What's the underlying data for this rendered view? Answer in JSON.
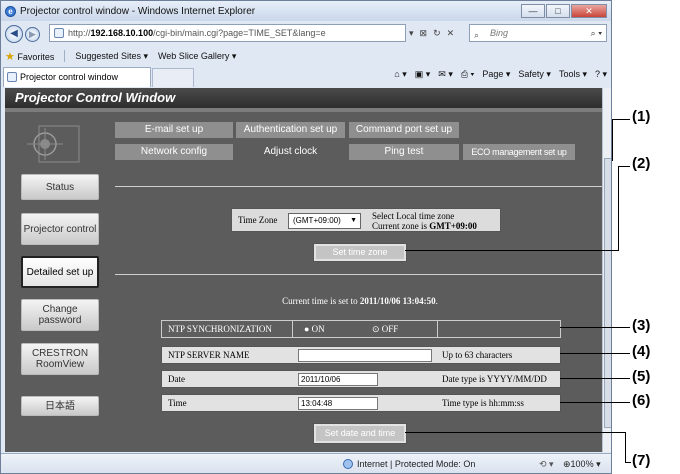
{
  "browser": {
    "window_title": "Projector control window - Windows Internet Explorer",
    "address_prefix": "http://",
    "address_host": "192.168.10.100",
    "address_path": "/cgi-bin/main.cgi?page=TIME_SET&lang=e",
    "search_placeholder": "Bing",
    "favorites_label": "Favorites",
    "suggested_sites": "Suggested Sites ▾",
    "web_slice": "Web Slice Gallery ▾",
    "tab_title": "Projector control window",
    "cmd_page": "Page ▾",
    "cmd_safety": "Safety ▾",
    "cmd_tools": "Tools ▾",
    "status_text": "Internet | Protected Mode: On",
    "zoom": "100%"
  },
  "header": {
    "title": "Projector Control Window"
  },
  "sidebar": {
    "items": [
      {
        "label": "Status"
      },
      {
        "label": "Projector control"
      },
      {
        "label": "Detailed set up"
      },
      {
        "label": "Change password"
      },
      {
        "label": "CRESTRON RoomView"
      },
      {
        "label": "日本語"
      }
    ]
  },
  "tabs": [
    {
      "label": "E-mail set up"
    },
    {
      "label": "Authentication set up"
    },
    {
      "label": "Command port set up"
    },
    {
      "label": "Network config"
    },
    {
      "label": "Adjust clock"
    },
    {
      "label": "Ping test"
    },
    {
      "label": "ECO management set up"
    }
  ],
  "timezone": {
    "label": "Time Zone",
    "value": "(GMT+09:00)",
    "info1": "Select Local time zone",
    "info2_prefix": "Current zone is ",
    "info2_value": "GMT+09:00",
    "button": "Set time zone"
  },
  "current_time": {
    "prefix": "Current time is set to ",
    "value": "2011/10/06 13:04:50",
    "suffix": "."
  },
  "form": {
    "ntp_label": "NTP SYNCHRONIZATION",
    "ntp_on": "● ON",
    "ntp_off": "⊙ OFF",
    "server_label": "NTP SERVER NAME",
    "server_value": "",
    "server_hint": "Up to 63 characters",
    "date_label": "Date",
    "date_value": "2011/10/06",
    "date_hint": "Date type is YYYY/MM/DD",
    "time_label": "Time",
    "time_value": "13:04:48",
    "time_hint": "Time type is hh:mm:ss",
    "set_button": "Set date and time"
  },
  "callouts": [
    "(1)",
    "(2)",
    "(3)",
    "(4)",
    "(5)",
    "(6)",
    "(7)"
  ]
}
